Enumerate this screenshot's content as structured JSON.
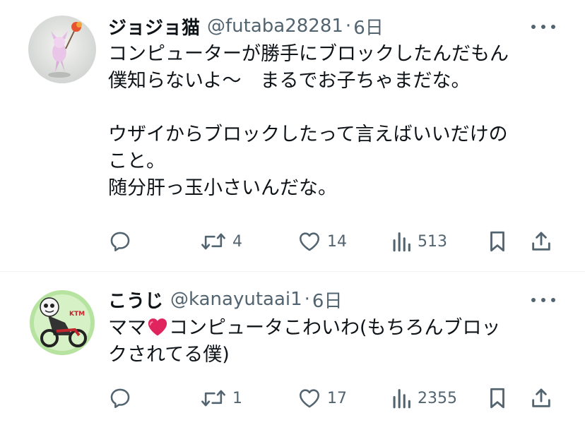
{
  "tweets": [
    {
      "name": "ジョジョ猫",
      "handle": "@futaba28281",
      "separator": "·",
      "time": "6日",
      "lines": [
        "コンピューターが勝手にブロックしたんだもん",
        "僕知らないよ〜　まるでお子ちゃまだな。",
        "",
        "ウザイからブロックしたって言えばいいだけの",
        "こと。",
        "随分肝っ玉小さいんだな。"
      ],
      "stats": {
        "replies": "",
        "reposts": "4",
        "likes": "14",
        "views": "513"
      }
    },
    {
      "name": "こうじ",
      "handle": "@kanayutaai1",
      "separator": "·",
      "time": "6日",
      "line1_before": "ママ",
      "line1_after": "コンピュータこわいわ(もちろんブロッ",
      "line2": "クされてる僕)",
      "stats": {
        "replies": "",
        "reposts": "1",
        "likes": "17",
        "views": "2355"
      }
    }
  ],
  "icons": {
    "more": "more-icon",
    "reply": "reply-icon",
    "repost": "repost-icon",
    "like": "like-icon",
    "views": "views-icon",
    "bookmark": "bookmark-icon",
    "share": "share-icon",
    "heart_emoji": "red-heart-emoji"
  },
  "colors": {
    "text_primary": "#0f1419",
    "text_secondary": "#536471",
    "divider": "#eff3f4",
    "heart": "#e0245e"
  }
}
